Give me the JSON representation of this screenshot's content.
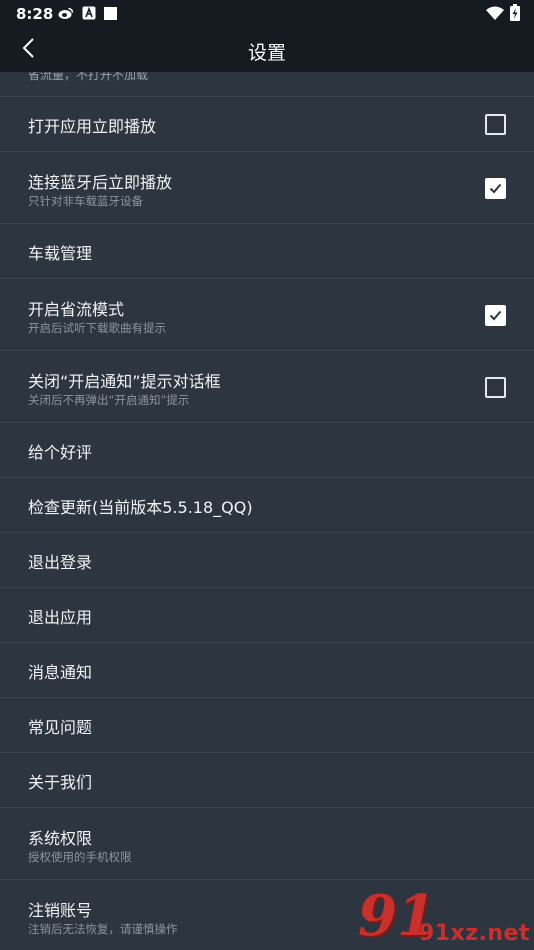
{
  "status_bar": {
    "time": "8:28",
    "left_icons": [
      "weibo-icon",
      "font-app-icon",
      "square-icon"
    ],
    "right_icons": [
      "wifi-icon",
      "battery-charging-icon"
    ]
  },
  "app_bar": {
    "title": "设置",
    "back_icon": "chevron-left-icon"
  },
  "partial_item": {
    "subtitle": "省流量，不打开不加载"
  },
  "settings": [
    {
      "title": "打开应用立即播放",
      "subtitle": "",
      "checkbox": true,
      "checked": false
    },
    {
      "title": "连接蓝牙后立即播放",
      "subtitle": "只针对非车载蓝牙设备",
      "checkbox": true,
      "checked": true
    },
    {
      "title": "车载管理",
      "subtitle": "",
      "checkbox": false
    },
    {
      "title": "开启省流模式",
      "subtitle": "开启后试听下载歌曲有提示",
      "checkbox": true,
      "checked": true
    },
    {
      "title": "关闭“开启通知”提示对话框",
      "subtitle": "关闭后不再弹出“开启通知”提示",
      "checkbox": true,
      "checked": false
    },
    {
      "title": "给个好评",
      "subtitle": "",
      "checkbox": false
    },
    {
      "title": "检查更新(当前版本5.5.18_QQ)",
      "subtitle": "",
      "checkbox": false
    },
    {
      "title": "退出登录",
      "subtitle": "",
      "checkbox": false
    },
    {
      "title": "退出应用",
      "subtitle": "",
      "checkbox": false
    },
    {
      "title": "消息通知",
      "subtitle": "",
      "checkbox": false
    },
    {
      "title": "常见问题",
      "subtitle": "",
      "checkbox": false
    },
    {
      "title": "关于我们",
      "subtitle": "",
      "checkbox": false
    },
    {
      "title": "系统权限",
      "subtitle": "授权使用的手机权限",
      "checkbox": false
    },
    {
      "title": "注销账号",
      "subtitle": "注销后无法恢复，请谨慎操作",
      "checkbox": false
    }
  ],
  "watermark": {
    "logo": "91",
    "text": "91xz.net"
  },
  "colors": {
    "background": "#2d3540",
    "bar": "#161b22",
    "divider": "#3a434f",
    "subtitle": "#8d949d",
    "watermark": "#c9302c"
  }
}
